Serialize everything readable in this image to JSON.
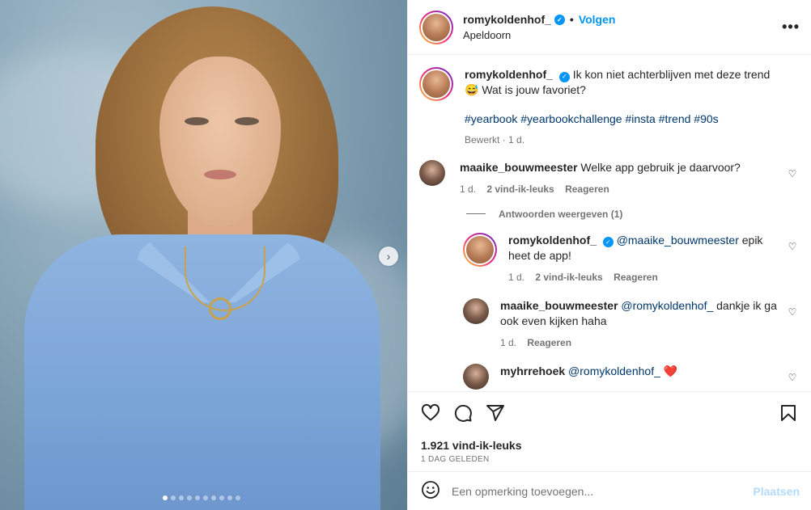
{
  "post": {
    "author": "romykoldenhof_",
    "follow_label": "Volgen",
    "location": "Apeldoorn",
    "more_label": "•••"
  },
  "caption": {
    "author": "romykoldenhof_",
    "text_line1": "Ik kon niet achterblijven met deze trend",
    "emoji": "😅",
    "text_line2": "Wat is jouw favoriet?",
    "hashtags": "#yearbook #yearbookchallenge #insta #trend #90s",
    "edited": "Bewerkt · 1 d."
  },
  "comments": [
    {
      "author": "maaike_bouwmeester",
      "text": "Welke app gebruik je daarvoor?",
      "age": "1 d.",
      "likes": "2 vind-ik-leuks",
      "reply_label": "Reageren"
    }
  ],
  "replies_toggle": "Antwoorden weergeven (1)",
  "replies": [
    {
      "author": "romykoldenhof_",
      "mention": "@maaike_bouwmeester",
      "text": "epik heet de app!",
      "age": "1 d.",
      "likes": "2 vind-ik-leuks",
      "reply_label": "Reageren"
    },
    {
      "author": "maaike_bouwmeester",
      "mention": "@romykoldenhof_",
      "text": "dankje ik ga ook even kijken haha",
      "age": "1 d.",
      "reply_label": "Reageren"
    },
    {
      "author": "myhrrehoek",
      "mention": "@romykoldenhof_",
      "text": "❤️"
    }
  ],
  "stats": {
    "likes": "1.921 vind-ik-leuks",
    "date": "1 DAG GELEDEN"
  },
  "add_comment": {
    "placeholder": "Een opmerking toevoegen...",
    "post_label": "Plaatsen"
  },
  "carousel": {
    "slides": 10,
    "active": 1
  },
  "colors": {
    "accent": "#0095f6",
    "link": "#00376b",
    "muted": "#737373",
    "heart": "#ed4956"
  },
  "icons": [
    "heart-icon",
    "comment-icon",
    "share-icon",
    "bookmark-icon",
    "emoji-icon",
    "more-icon",
    "verified-icon",
    "next-arrow-icon"
  ]
}
